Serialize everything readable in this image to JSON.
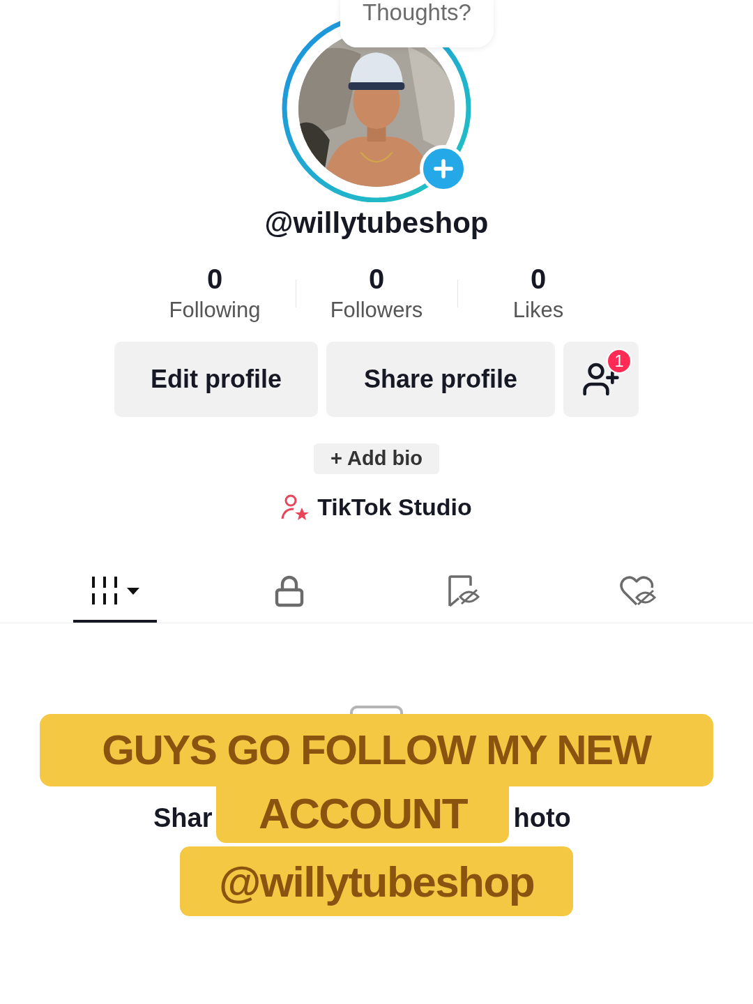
{
  "story_bubble": {
    "text": "Thoughts?"
  },
  "avatar": {
    "kind": "picture"
  },
  "username": "@willytubeshop",
  "stats": [
    {
      "value": "0",
      "label": "Following"
    },
    {
      "value": "0",
      "label": "Followers"
    },
    {
      "value": "0",
      "label": "Likes"
    }
  ],
  "buttons": [
    {
      "label": "Edit profile"
    },
    {
      "label": "Share profile"
    }
  ],
  "friends_button": {
    "badge": "1"
  },
  "add_bio": "+ Add bio",
  "studio_link": "TikTok Studio",
  "tabs": [
    {
      "kind": "videos",
      "selected": true
    },
    {
      "kind": "private",
      "selected": false
    },
    {
      "kind": "reposts",
      "selected": false
    },
    {
      "kind": "liked",
      "selected": false
    }
  ],
  "empty_state": {
    "text_start": "Shar",
    "text_end": "hoto"
  },
  "caption": [
    "GUYS GO FOLLOW MY NEW",
    "ACCOUNT",
    "@willytubeshop"
  ]
}
